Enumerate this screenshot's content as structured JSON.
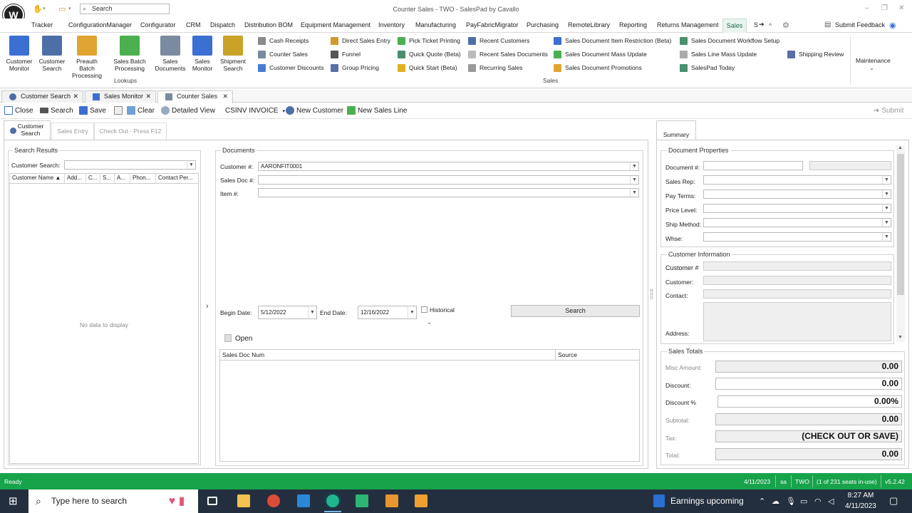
{
  "titlebar": {
    "title": "Counter Sales - TWO - SalesPad by Cavallo",
    "search_placeholder": "Search",
    "logo_text": "W",
    "min": "–",
    "max": "❐",
    "close": "✕"
  },
  "menu": {
    "items": [
      "Tracker",
      "ConfigurationManager",
      "Configurator",
      "CRM",
      "Dispatch",
      "Distribution BOM",
      "Equipment Management",
      "Inventory",
      "Manufacturing",
      "PayFabricMigrator",
      "Purchasing",
      "RemoteLibrary",
      "Reporting",
      "Returns Management",
      "Sales",
      "S"
    ],
    "overflow": "➔",
    "caret": "^",
    "submit_feedback": "Submit Feedback"
  },
  "ribbon": {
    "big_buttons": [
      {
        "label": "Customer Monitor",
        "color": "#3b6fd1"
      },
      {
        "label": "Customer Search",
        "color": "#4d6fa8"
      },
      {
        "label": "Preauth Batch Processing",
        "color": "#e0a531"
      },
      {
        "label": "Sales Batch Processing",
        "color": "#4caf50"
      },
      {
        "label": "Sales Documents",
        "color": "#7a8aa0"
      },
      {
        "label": "Sales Monitor",
        "color": "#3b6fd1"
      },
      {
        "label": "Shipment Search",
        "color": "#c9a227"
      }
    ],
    "lookups_label": "Lookups",
    "small": [
      {
        "label": "Cash Receipts",
        "color": "#8a8a8a"
      },
      {
        "label": "Counter Sales",
        "color": "#7a8aa0"
      },
      {
        "label": "Customer Discounts",
        "color": "#4a7bd1"
      },
      {
        "label": "Direct Sales Entry",
        "color": "#d19a2a"
      },
      {
        "label": "Funnel",
        "color": "#555"
      },
      {
        "label": "Group Pricing",
        "color": "#5a6fa8"
      },
      {
        "label": "Pick Ticket Printing",
        "color": "#4caf50"
      },
      {
        "label": "Quick Quote (Beta)",
        "color": "#4a8f6e"
      },
      {
        "label": "Quick Start (Beta)",
        "color": "#e0b020"
      },
      {
        "label": "Recent Customers",
        "color": "#4d6fa8"
      },
      {
        "label": "Recent Sales Documents",
        "color": "#bbbbbb"
      },
      {
        "label": "Recurring Sales",
        "color": "#999"
      },
      {
        "label": "Sales Document Item Restriction (Beta)",
        "color": "#3b6fd1"
      },
      {
        "label": "Sales Document Mass Update",
        "color": "#4caf50"
      },
      {
        "label": "Sales Document Promotions",
        "color": "#e0a531"
      },
      {
        "label": "Sales Document Workflow Setup",
        "color": "#4a8f6e"
      },
      {
        "label": "Sales Line Mass Update",
        "color": "#aaa"
      },
      {
        "label": "SalesPad Today",
        "color": "#4a8f6e"
      },
      {
        "label": "Shipping Review",
        "color": "#5a6fa8"
      }
    ],
    "sales_label": "Sales",
    "maintenance_label": "Maintenance",
    "maintenance_caret": "⌄"
  },
  "doc_tabs": [
    {
      "label": "Customer Search",
      "color": "#4d6fa8"
    },
    {
      "label": "Sales Monitor",
      "color": "#3b6fd1"
    },
    {
      "label": "Counter Sales",
      "color": "#7a8aa0"
    }
  ],
  "toolbar": {
    "close": "Close",
    "search": "Search",
    "save": "Save",
    "clear": "Clear",
    "detailed_view": "Detailed View",
    "csinv": "CSINV INVOICE",
    "new_customer": "New Customer",
    "new_sales_line": "New Sales Line",
    "submit": "Submit"
  },
  "panel_tabs": {
    "customer_search": "Customer Search",
    "sales_entry": "Sales Entry",
    "check_out": "Check Out - Press F12"
  },
  "search_results": {
    "title": "Search Results",
    "customer_search_label": "Customer Search:",
    "columns": [
      "Customer Name",
      "Add...",
      "C...",
      "S...",
      "A...",
      "Phon...",
      "Contact Per..."
    ],
    "empty": "No data to display"
  },
  "documents": {
    "title": "Documents",
    "customer_label": "Customer #:",
    "customer_value": "AARONFIT0001",
    "sales_doc_label": "Sales Doc #:",
    "item_label": "Item #:",
    "begin_label": "Begin Date:",
    "begin_value": "5/12/2022",
    "end_label": "End Date:",
    "end_value": "12/16/2022",
    "historical": "Historical",
    "search_btn": "Search",
    "open_label": "Open",
    "columns": [
      "Sales Doc Num",
      "Source"
    ],
    "expand_arrow": "›",
    "collapse_arrow": "⌃"
  },
  "summary": {
    "tab": "Summary",
    "doc_props": "Document Properties",
    "document_label": "Document #:",
    "sales_rep_label": "Sales Rep:",
    "pay_terms_label": "Pay Terms:",
    "price_level_label": "Price Level:",
    "ship_method_label": "Ship Method:",
    "whse_label": "Whse:",
    "cust_info": "Customer Information",
    "customer_num_label": "Customer #",
    "customer_label": "Customer:",
    "contact_label": "Contact:",
    "address_label": "Address:",
    "totals_title": "Sales Totals",
    "misc_label": "Misc Amount:",
    "misc_value": "0.00",
    "discount_label": "Discount:",
    "discount_value": "0.00",
    "discount_pct_label": "Discount %",
    "discount_pct_value": "0.00%",
    "subtotal_label": "Subtotal:",
    "subtotal_value": "0.00",
    "tax_label": "Tax:",
    "tax_value": "(CHECK OUT OR SAVE)",
    "total_label": "Total:",
    "total_value": "0.00"
  },
  "status": {
    "ready": "Ready",
    "date": "4/11/2023",
    "user": "sa",
    "company": "TWO",
    "seats": "(1 of 231 seats in-use)",
    "version": "v5.2.42"
  },
  "taskbar": {
    "search_placeholder": "Type here to search",
    "news": "Earnings upcoming",
    "time": "8:27 AM",
    "date": "4/11/2023",
    "apps": [
      {
        "name": "task-view",
        "color": "#ffffff"
      },
      {
        "name": "explorer",
        "color": "#f2c14e"
      },
      {
        "name": "chrome",
        "color": "#dd4b39"
      },
      {
        "name": "chart",
        "color": "#2b88d8"
      },
      {
        "name": "salespad",
        "color": "#1fb58f"
      },
      {
        "name": "barcode",
        "color": "#2bb673"
      },
      {
        "name": "truck",
        "color": "#e8962f"
      },
      {
        "name": "notes",
        "color": "#f0a030"
      }
    ]
  },
  "colors": {
    "accent": "#17a34a",
    "taskbar": "#232f3e"
  }
}
